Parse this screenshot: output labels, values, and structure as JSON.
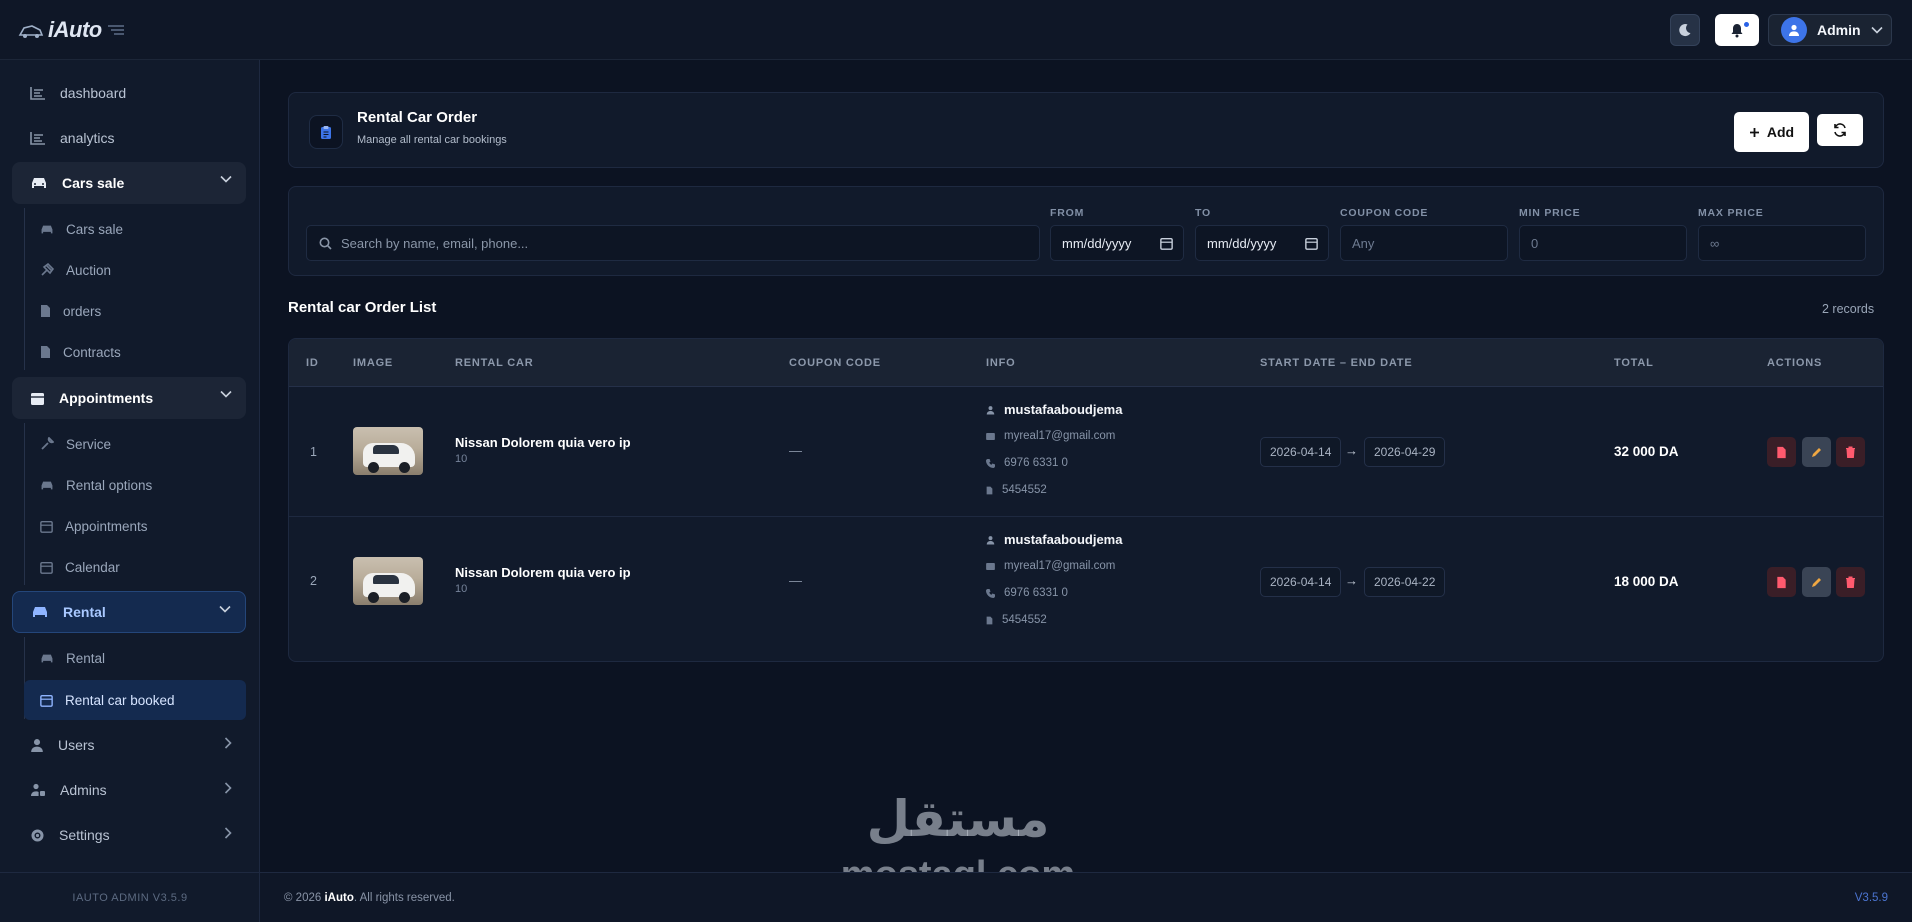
{
  "app": {
    "logo_text": "iAuto"
  },
  "topbar": {
    "admin_label": "Admin"
  },
  "sidebar": {
    "items": [
      {
        "label": "dashboard"
      },
      {
        "label": "analytics"
      },
      {
        "label": "Cars sale"
      },
      {
        "label": "Cars sale"
      },
      {
        "label": "Auction"
      },
      {
        "label": "orders"
      },
      {
        "label": "Contracts"
      },
      {
        "label": "Appointments"
      },
      {
        "label": "Service"
      },
      {
        "label": "Rental options"
      },
      {
        "label": "Appointments"
      },
      {
        "label": "Calendar"
      },
      {
        "label": "Rental"
      },
      {
        "label": "Rental"
      },
      {
        "label": "Rental car booked"
      },
      {
        "label": "Users"
      },
      {
        "label": "Admins"
      },
      {
        "label": "Settings"
      }
    ],
    "footer": "IAUTO ADMIN V3.5.9"
  },
  "header": {
    "title": "Rental Car Order",
    "subtitle": "Manage all rental car bookings",
    "add_label": "Add"
  },
  "filters": {
    "search_placeholder": "Search by name, email, phone...",
    "from_label": "FROM",
    "from_value": "mm/dd/yyyy",
    "to_label": "TO",
    "to_value": "mm/dd/yyyy",
    "coupon_label": "COUPON CODE",
    "coupon_placeholder": "Any",
    "min_label": "MIN PRICE",
    "min_placeholder": "0",
    "max_label": "MAX PRICE",
    "max_placeholder": "∞"
  },
  "list": {
    "title": "Rental car Order List",
    "records": "2 records"
  },
  "table": {
    "headers": [
      "ID",
      "IMAGE",
      "RENTAL CAR",
      "COUPON CODE",
      "INFO",
      "START DATE – END DATE",
      "TOTAL",
      "ACTIONS"
    ],
    "rows": [
      {
        "id": "1",
        "car_name": "Nissan Dolorem quia vero ip",
        "car_sub": "10",
        "coupon": "—",
        "user": "mustafaaboudjema",
        "email": "myreal17@gmail.com",
        "phone": "6976 6331 0",
        "doc": "5454552",
        "start": "2026-04-14",
        "end": "2026-04-29",
        "total": "32 000 DA"
      },
      {
        "id": "2",
        "car_name": "Nissan Dolorem quia vero ip",
        "car_sub": "10",
        "coupon": "—",
        "user": "mustafaaboudjema",
        "email": "myreal17@gmail.com",
        "phone": "6976 6331 0",
        "doc": "5454552",
        "start": "2026-04-14",
        "end": "2026-04-22",
        "total": "18 000 DA"
      }
    ]
  },
  "footer": {
    "year_prefix": "© 2026",
    "brand": "iAuto",
    "suffix": ". All rights reserved.",
    "version": "V3.5.9"
  },
  "watermark": {
    "arabic": "مستقل",
    "latin": "mostaql.com"
  }
}
